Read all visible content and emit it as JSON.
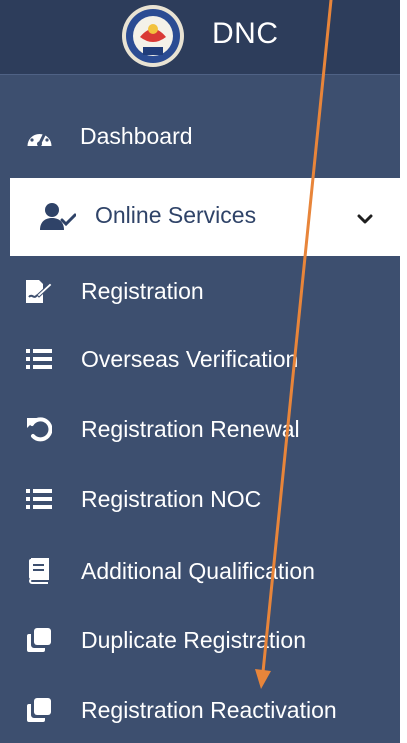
{
  "brand": {
    "title": "DNC",
    "logo_icon": "dnc-seal-icon"
  },
  "sidebar": {
    "dashboard": {
      "label": "Dashboard",
      "icon": "speedometer-icon"
    },
    "online_services": {
      "label": "Online Services",
      "icon": "user-check-icon",
      "chevron": "chevron-down-icon"
    },
    "items": [
      {
        "label": "Registration",
        "icon": "file-signature-icon"
      },
      {
        "label": "Overseas Verification",
        "icon": "list-icon"
      },
      {
        "label": "Registration Renewal",
        "icon": "undo-icon"
      },
      {
        "label": "Registration NOC",
        "icon": "list-icon"
      },
      {
        "label": "Additional Qualification",
        "icon": "book-icon"
      },
      {
        "label": "Duplicate Registration",
        "icon": "clone-icon"
      },
      {
        "label": "Registration Reactivation",
        "icon": "clone-icon"
      }
    ]
  },
  "colors": {
    "sidebar_bg": "#3d4f6f",
    "header_bg": "#2d3d5b",
    "active_bg": "#ffffff",
    "active_text": "#2f4368",
    "annotation_arrow": "#e8853a"
  }
}
